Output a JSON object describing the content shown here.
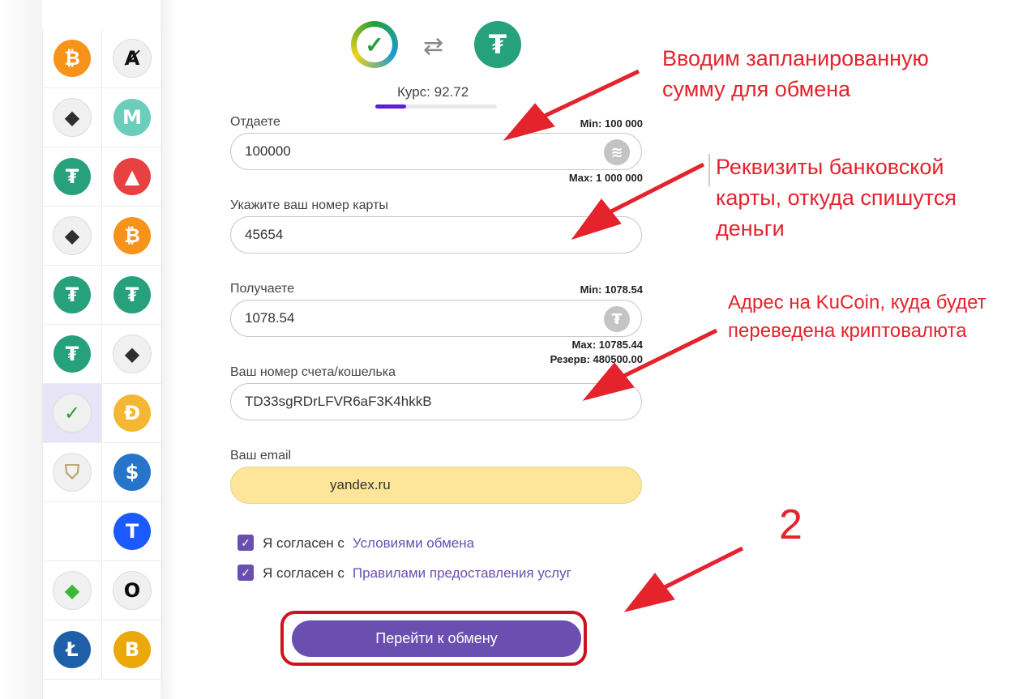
{
  "sidebar": {
    "coins_left": [
      {
        "icon": "bitcoin-icon",
        "glyph": "₿",
        "color": "#f7931a"
      },
      {
        "icon": "ethereum-icon",
        "glyph": "◆",
        "color": "#2f2f2f"
      },
      {
        "icon": "tether-icon",
        "glyph": "₮",
        "color": "#26a17b"
      },
      {
        "icon": "ethereum-icon",
        "glyph": "◆",
        "color": "#2f2f2f"
      },
      {
        "icon": "tether-icon",
        "glyph": "₮",
        "color": "#26a17b"
      },
      {
        "icon": "tether-icon",
        "glyph": "₮",
        "color": "#26a17b"
      },
      {
        "icon": "sberbank-icon",
        "glyph": "✓",
        "color": "#21a038"
      },
      {
        "icon": "tinkoff-emblem-icon",
        "glyph": "⛉",
        "color": "#b9a26a"
      },
      {
        "icon": "",
        "glyph": "",
        "color": ""
      },
      {
        "icon": "ethereum-classic-icon",
        "glyph": "◆",
        "color": "#3ab83a"
      },
      {
        "icon": "litecoin-icon",
        "glyph": "Ł",
        "color": "#1f5fa8"
      }
    ],
    "coins_right": [
      {
        "icon": "algorand-icon",
        "glyph": "Ⱥ",
        "color": "#111111"
      },
      {
        "icon": "maker-icon",
        "glyph": "M",
        "color": "#6acebb"
      },
      {
        "icon": "avalanche-icon",
        "glyph": "▲",
        "color": "#e84142"
      },
      {
        "icon": "bitcoin-icon",
        "glyph": "₿",
        "color": "#f7931a"
      },
      {
        "icon": "tether-icon",
        "glyph": "₮",
        "color": "#26a17b"
      },
      {
        "icon": "ethereum-icon",
        "glyph": "◆",
        "color": "#2f2f2f"
      },
      {
        "icon": "dai-icon",
        "glyph": "Đ",
        "color": "#f4b731"
      },
      {
        "icon": "usdc-icon",
        "glyph": "$",
        "color": "#2775ca"
      },
      {
        "icon": "trueusd-icon",
        "glyph": "T",
        "color": "#1a5aff"
      },
      {
        "icon": "ocean-icon",
        "glyph": "O",
        "color": "#0b0b0b"
      },
      {
        "icon": "bitcoin-gold-icon",
        "glyph": "B",
        "color": "#eba809"
      }
    ]
  },
  "exchange": {
    "from_icon": "sberbank-icon",
    "to_icon": "tether-icon",
    "swap_icon": "swap-arrows-icon",
    "rate_label": "Курс: 92.72",
    "progress": 0.25
  },
  "give": {
    "label": "Отдаете",
    "min": "Min: 100 000",
    "value": "100000",
    "max": "Max: 1 000 000",
    "icon": "sberbank-icon"
  },
  "card": {
    "label": "Укажите ваш номер карты",
    "value": "45654"
  },
  "receive": {
    "label": "Получаете",
    "min": "Min: 1078.54",
    "value": "1078.54",
    "max": "Max: 10785.44",
    "reserve": "Резерв: 480500.00",
    "icon": "tether-icon"
  },
  "wallet": {
    "label": "Ваш номер счета/кошелька",
    "value": "TD33sgRDrLFVR6aF3K4hkkB"
  },
  "email": {
    "label": "Ваш email",
    "value": "yandex.ru"
  },
  "agreements": [
    {
      "prefix": "Я согласен с",
      "link": "Условиями обмена"
    },
    {
      "prefix": "Я согласен с",
      "link": "Правилами предоставления услуг"
    }
  ],
  "submit_label": "Перейти к обмену",
  "annotations": {
    "amount": [
      "Вводим запланированную",
      "сумму для обмена"
    ],
    "card": [
      "Реквизиты банковской",
      "карты, откуда спишутся",
      "деньги"
    ],
    "wallet": [
      "Адрес на KuCoin, куда будет",
      "переведена криптовалюта"
    ],
    "step": "2"
  },
  "colors": {
    "accent": "#6a4fb0",
    "annotation": "#e4232d"
  }
}
